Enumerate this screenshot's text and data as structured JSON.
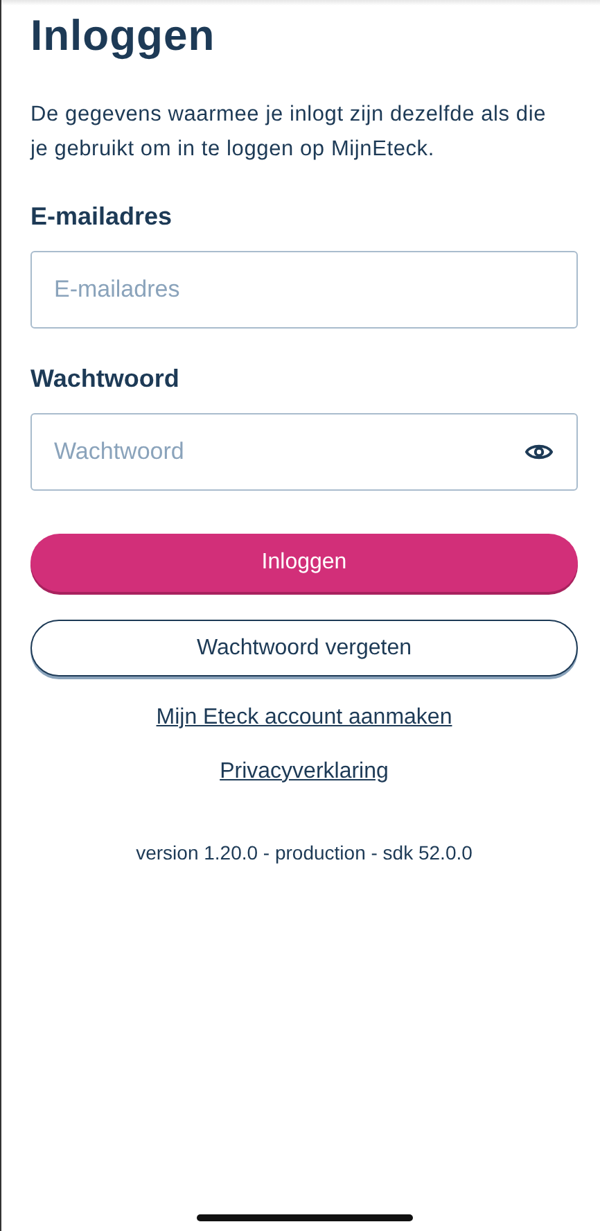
{
  "title": "Inloggen",
  "intro": "De gegevens waarmee je inlogt zijn dezelfde als die je gebruikt om in te loggen op MijnEteck.",
  "fields": [
    {
      "label": "E-mailadres",
      "placeholder": "E-mailadres",
      "kind": "email"
    },
    {
      "label": "Wachtwoord",
      "placeholder": "Wachtwoord",
      "kind": "password"
    }
  ],
  "primary_button": "Inloggen",
  "secondary_button": "Wachtwoord vergeten",
  "links": [
    "Mijn Eteck account aanmaken",
    "Privacyverklaring"
  ],
  "version": "version 1.20.0 - production - sdk 52.0.0"
}
